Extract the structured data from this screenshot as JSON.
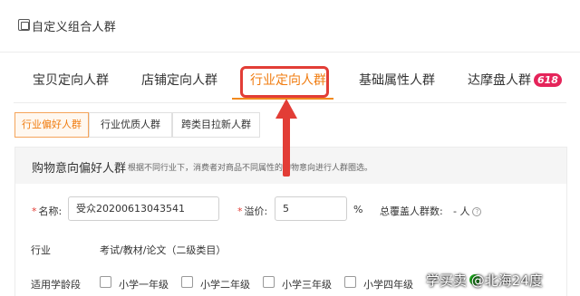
{
  "header": {
    "title": "自定义组合人群",
    "icon": "custom-group-icon"
  },
  "tabs": [
    {
      "label": "宝贝定向人群"
    },
    {
      "label": "店铺定向人群"
    },
    {
      "label": "行业定向人群",
      "active": true
    },
    {
      "label": "基础属性人群"
    },
    {
      "label": "达摩盘人群",
      "badge": "618"
    }
  ],
  "subtabs": [
    {
      "label": "行业偏好人群",
      "active": true
    },
    {
      "label": "行业优质人群"
    },
    {
      "label": "跨类目拉新人群"
    }
  ],
  "panel": {
    "title": "购物意向偏好人群",
    "description": "根据不同行业下，消费者对商品不同属性的购物意向进行人群圈选。"
  },
  "form": {
    "name_label": "名称:",
    "name_value": "受众20200613043541",
    "premium_label": "溢价:",
    "premium_value": "5",
    "premium_unit": "%",
    "coverage_label": "总覆盖人群数:",
    "coverage_value": "-",
    "coverage_unit": "人",
    "industry_label": "行业",
    "industry_value": "考试/教材/论文（二级类目）",
    "grade_label": "适用学龄段",
    "grade_options": [
      "小学一年级",
      "小学二年级",
      "小学三年级",
      "小学四年级"
    ]
  },
  "watermark": "学买卖 @北海24度",
  "colors": {
    "accent": "#f07c10",
    "highlight": "#e23d36",
    "badge": "#e5245a"
  }
}
